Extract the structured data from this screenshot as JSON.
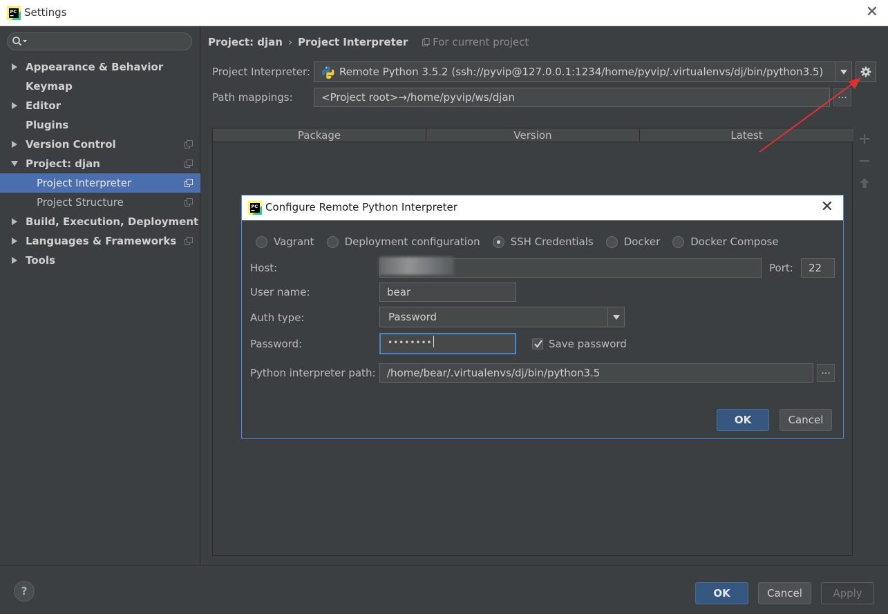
{
  "window": {
    "title": "Settings",
    "close_glyph": "✕"
  },
  "sidebar": {
    "search_placeholder": "",
    "items": [
      {
        "label": "Appearance & Behavior",
        "level": 0,
        "expandable": true,
        "expanded": false,
        "scoped": false,
        "selected": false
      },
      {
        "label": "Keymap",
        "level": 0,
        "expandable": false,
        "scoped": false,
        "selected": false
      },
      {
        "label": "Editor",
        "level": 0,
        "expandable": true,
        "expanded": false,
        "scoped": false,
        "selected": false
      },
      {
        "label": "Plugins",
        "level": 0,
        "expandable": false,
        "scoped": false,
        "selected": false
      },
      {
        "label": "Version Control",
        "level": 0,
        "expandable": true,
        "expanded": false,
        "scoped": true,
        "selected": false
      },
      {
        "label": "Project: djan",
        "level": 0,
        "expandable": true,
        "expanded": true,
        "scoped": true,
        "selected": false
      },
      {
        "label": "Project Interpreter",
        "level": 1,
        "expandable": false,
        "scoped": true,
        "selected": true
      },
      {
        "label": "Project Structure",
        "level": 1,
        "expandable": false,
        "scoped": true,
        "selected": false
      },
      {
        "label": "Build, Execution, Deployment",
        "level": 0,
        "expandable": true,
        "expanded": false,
        "scoped": false,
        "selected": false
      },
      {
        "label": "Languages & Frameworks",
        "level": 0,
        "expandable": true,
        "expanded": false,
        "scoped": true,
        "selected": false
      },
      {
        "label": "Tools",
        "level": 0,
        "expandable": true,
        "expanded": false,
        "scoped": false,
        "selected": false
      }
    ]
  },
  "main": {
    "breadcrumb": {
      "parent": "Project: djan",
      "separator": "›",
      "current": "Project Interpreter",
      "scope": "For current project"
    },
    "interpreter": {
      "label": "Project Interpreter:",
      "value": "Remote Python 3.5.2 (ssh://pyvip@127.0.0.1:1234/home/pyvip/.virtualenvs/dj/bin/python3.5)"
    },
    "path_mappings": {
      "label": "Path mappings:",
      "value": "<Project root>→/home/pyvip/ws/djan",
      "browse": "..."
    },
    "table": {
      "columns": [
        "Package",
        "Version",
        "Latest"
      ],
      "rows": []
    }
  },
  "dialog": {
    "title": "Configure Remote Python Interpreter",
    "close_glyph": "✕",
    "options": [
      {
        "label": "Vagrant",
        "selected": false
      },
      {
        "label": "Deployment configuration",
        "selected": false
      },
      {
        "label": "SSH Credentials",
        "selected": true
      },
      {
        "label": "Docker",
        "selected": false
      },
      {
        "label": "Docker Compose",
        "selected": false
      }
    ],
    "host": {
      "label": "Host:",
      "value": ""
    },
    "port": {
      "label": "Port:",
      "value": "22"
    },
    "username": {
      "label": "User name:",
      "value": "bear"
    },
    "auth_type": {
      "label": "Auth type:",
      "value": "Password"
    },
    "password": {
      "label": "Password:",
      "masked": "••••••••"
    },
    "save_password": {
      "label": "Save password",
      "checked": true
    },
    "interpreter_path": {
      "label": "Python interpreter path:",
      "value": "/home/bear/.virtualenvs/dj/bin/python3.5",
      "browse": "..."
    },
    "ok": "OK",
    "cancel": "Cancel"
  },
  "footer": {
    "help": "?",
    "ok": "OK",
    "cancel": "Cancel",
    "apply": "Apply"
  },
  "colors": {
    "accent": "#4b6eaf",
    "primary_button": "#365880",
    "annotation_arrow": "#e03030",
    "dialog_border": "#4a8edb"
  }
}
